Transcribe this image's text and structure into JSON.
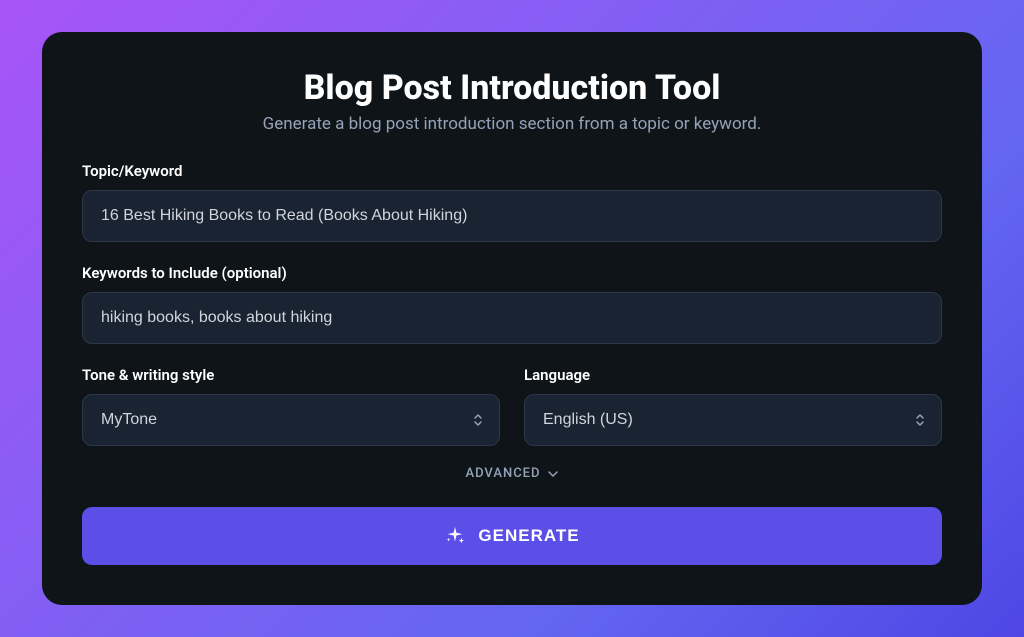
{
  "header": {
    "title": "Blog Post Introduction Tool",
    "subtitle": "Generate a blog post introduction section from a topic or keyword."
  },
  "form": {
    "topic": {
      "label": "Topic/Keyword",
      "value": "16 Best Hiking Books to Read (Books About Hiking)"
    },
    "keywords": {
      "label": "Keywords to Include (optional)",
      "value": "hiking books, books about hiking"
    },
    "tone": {
      "label": "Tone & writing style",
      "value": "MyTone"
    },
    "language": {
      "label": "Language",
      "value": "English (US)"
    },
    "advanced_label": "ADVANCED",
    "generate_label": "GENERATE"
  }
}
